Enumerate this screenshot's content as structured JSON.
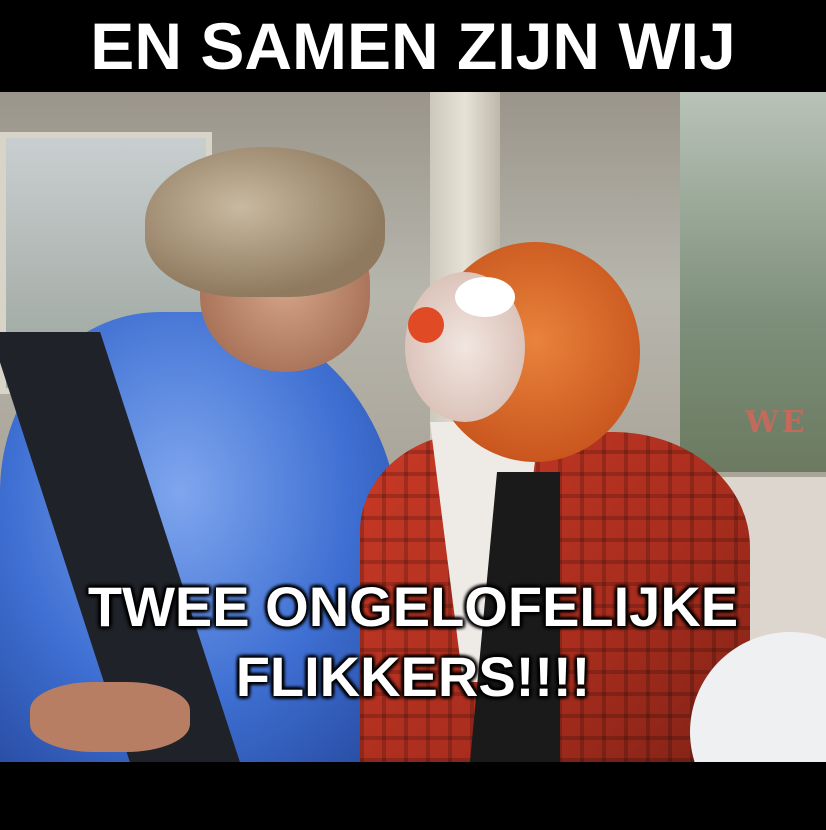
{
  "meme": {
    "top_caption": "EN SAMEN ZIJN WIJ",
    "bottom_caption_line1": "TWEE ONGELOFELIJKE",
    "bottom_caption_line2": "FLIKKERS!!!!",
    "background_sign_text": "WE",
    "colors": {
      "band": "#000000",
      "caption_text": "#ffffff",
      "shirt_blue": "#3e6fd2",
      "clown_hair_orange": "#e9833c",
      "jacket_red": "#c93a26"
    }
  }
}
